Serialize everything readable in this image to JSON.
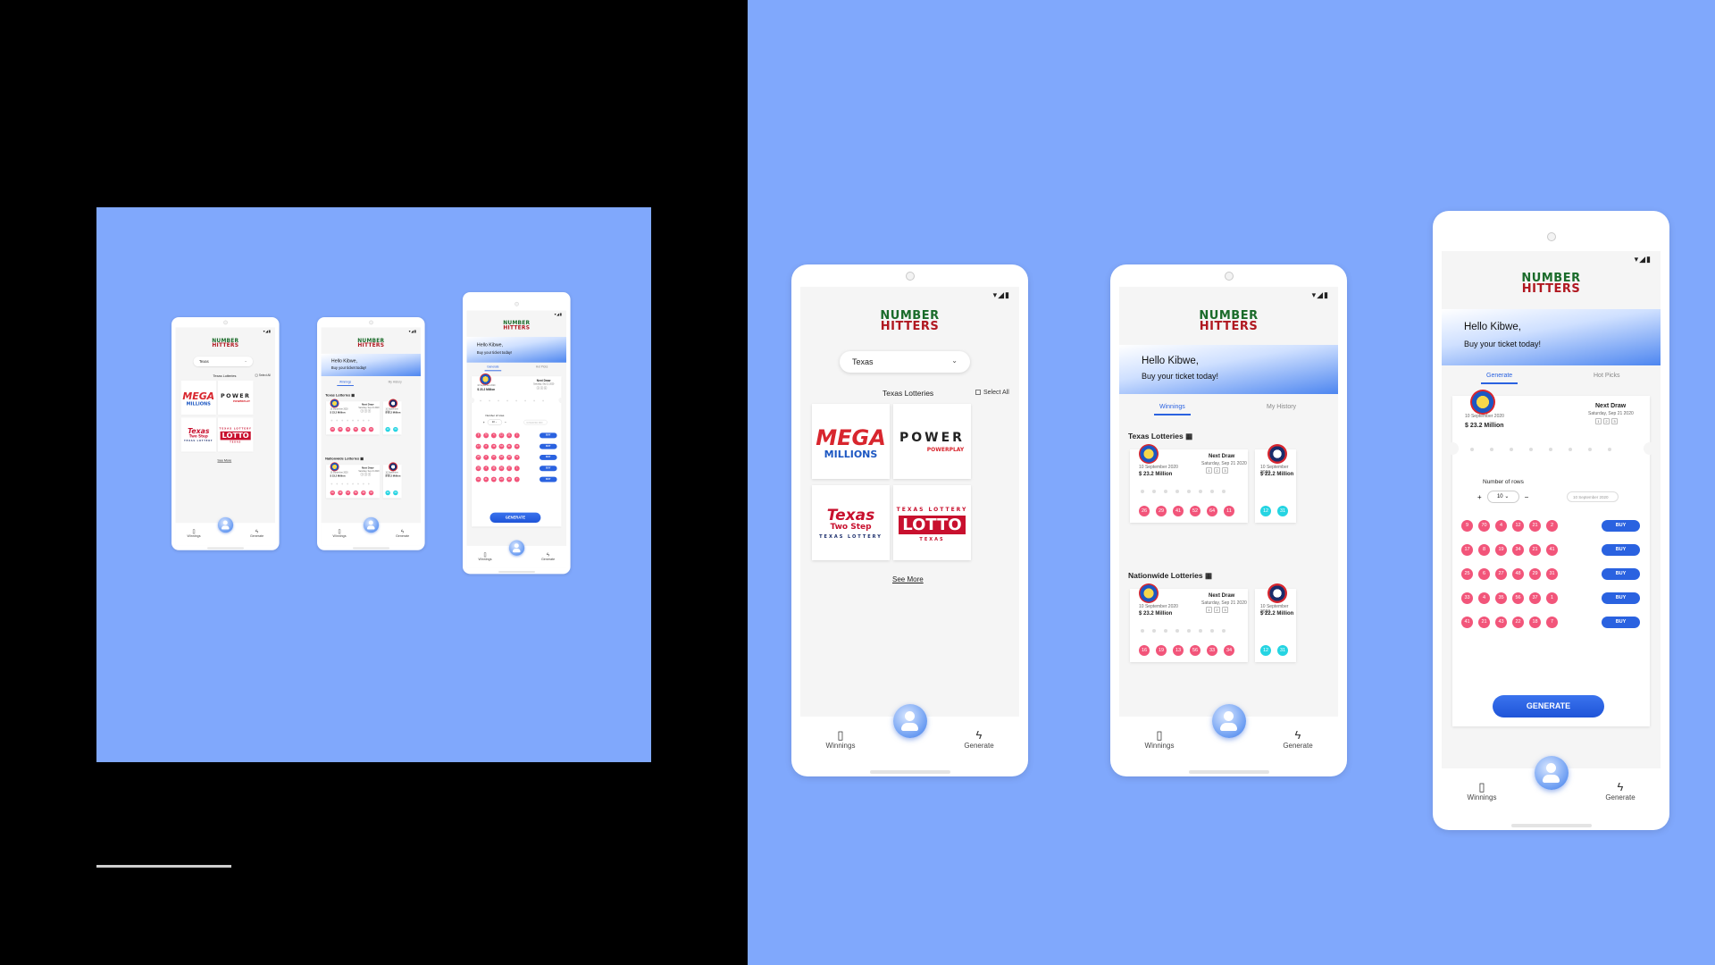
{
  "colors": {
    "background_left": "#000000",
    "background_right": "#80a8fc",
    "accent": "#2a62e0",
    "ball_pink": "#f2557a",
    "ball_cyan": "#25d4e2",
    "logo_green": "#1a6b2a",
    "logo_red": "#b01820"
  },
  "app": {
    "logo_line1": "NUMBER",
    "logo_line2": "HITTERS",
    "status_icons": "▾◢▮"
  },
  "nav": {
    "winnings": "Winnings",
    "generate": "Generate",
    "winnings_icon": "bar-chart-icon",
    "generate_icon": "bolt-icon"
  },
  "select_screen": {
    "state": "Texas",
    "section_title": "Texas Lotteries",
    "select_all": "Select All",
    "see_more": "See More",
    "lotteries": [
      {
        "name": "MEGA MILLIONS",
        "brand_line1": "MEGA",
        "brand_line2": "MILLIONS"
      },
      {
        "name": "POWERBALL",
        "brand_line1": "POWER",
        "brand_line2": "POWERPLAY"
      },
      {
        "name": "TEXAS TWO STEP",
        "brand_line1": "Texas",
        "brand_line2": "Two Step",
        "brand_line3": "TEXAS LOTTERY"
      },
      {
        "name": "LOTTO TEXAS",
        "brand_line1": "TEXAS LOTTERY",
        "brand_line2": "LOTTO",
        "brand_line3": "TEXAS"
      }
    ]
  },
  "hero": {
    "greeting": "Hello Kibwe,",
    "subtitle": "Buy your ticket today!"
  },
  "winnings_screen": {
    "tabs": [
      "Winnings",
      "My History"
    ],
    "groups": [
      {
        "title": "Texas Lotteries",
        "card": {
          "date": "10 September 2020",
          "amount": "$ 23.2 Million",
          "next_draw_label": "Next Draw",
          "next_draw_date": "Saturday, Sep 21 2020",
          "balls": [
            "26",
            "29",
            "41",
            "52",
            "64",
            "11"
          ]
        },
        "mini": {
          "date": "10 September 2020",
          "amount": "$ 22.2 Million",
          "balls": [
            "12",
            "31"
          ]
        }
      },
      {
        "title": "Nationwide Lotteries",
        "card": {
          "date": "10 September 2020",
          "amount": "$ 23.2 Million",
          "next_draw_label": "Next Draw",
          "next_draw_date": "Saturday, Sep 21 2020",
          "balls": [
            "16",
            "19",
            "13",
            "56",
            "33",
            "34"
          ]
        },
        "mini": {
          "date": "10 September 2020",
          "amount": "$ 22.2 Million",
          "balls": [
            "12",
            "31"
          ]
        }
      }
    ]
  },
  "generate_screen": {
    "tabs": [
      "Generate",
      "Hot Picks"
    ],
    "date": "10 September 2020",
    "amount": "$ 23.2 Million",
    "next_draw_label": "Next Draw",
    "next_draw_date": "Saturday, Sep 21 2020",
    "rows_label": "Number of rows",
    "rows_value": "10",
    "date_placeholder": "10 September 2020",
    "buy_label": "BUY",
    "generate_label": "GENERATE",
    "rows": [
      [
        "9",
        "70",
        "4",
        "12",
        "21",
        "2"
      ],
      [
        "17",
        "8",
        "19",
        "34",
        "21",
        "41"
      ],
      [
        "25",
        "6",
        "27",
        "48",
        "29",
        "31"
      ],
      [
        "33",
        "4",
        "35",
        "56",
        "37",
        "1"
      ],
      [
        "41",
        "21",
        "43",
        "22",
        "18",
        "7"
      ]
    ]
  }
}
